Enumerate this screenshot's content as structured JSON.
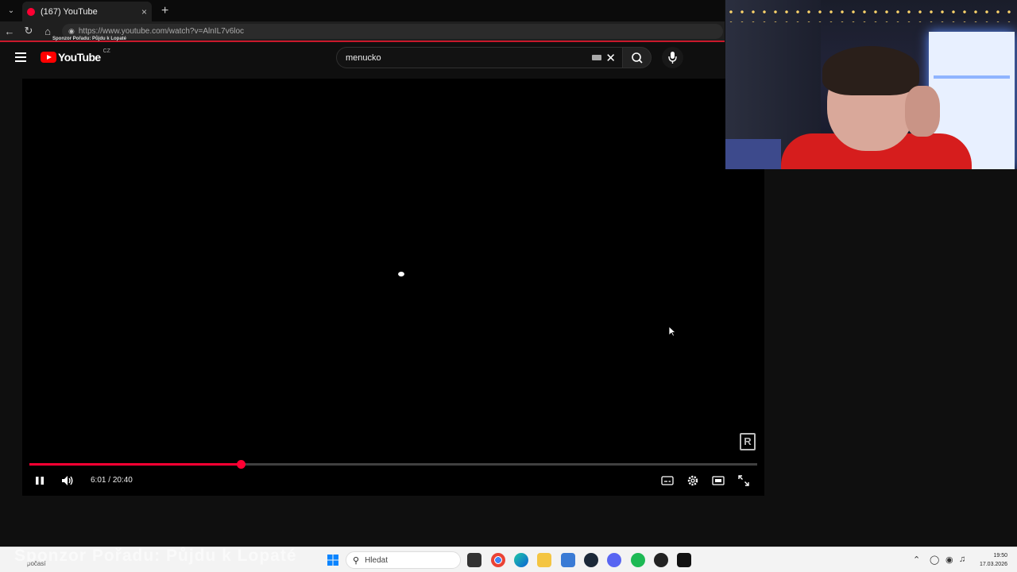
{
  "browser": {
    "tab_title": "(167) YouTube",
    "tab_close": "×",
    "new_tab": "+",
    "url_host": "https://www.youtube.com",
    "url_path": "/watch?v=AlnIL7v6loc",
    "overlay_sponsor": "Sponzor Pořadu: Půjdu k Lopaté"
  },
  "youtube": {
    "logo_text": "YouTube",
    "country_code": "CZ",
    "search_value": "menucko"
  },
  "player": {
    "progress_fraction": 0.29,
    "current_time": "6:01",
    "duration": "20:40",
    "time_separator": " / ",
    "watermark_letter": "R"
  },
  "stream": {
    "sponsor_watermark": "Sponzor Pořadu: Půjdu k Lopaté"
  },
  "taskbar": {
    "search_placeholder": "Hledat",
    "left_tag": "počasí",
    "time": "19:50",
    "date": "17.03.2026",
    "apps": [
      "windows-start",
      "task-view",
      "chrome",
      "edge",
      "file-explorer",
      "notepad",
      "steam",
      "discord",
      "spotify",
      "app-red",
      "capcut"
    ]
  },
  "colors": {
    "accent": "#ff0033",
    "background": "#0f0f0f",
    "player": "#000000"
  }
}
